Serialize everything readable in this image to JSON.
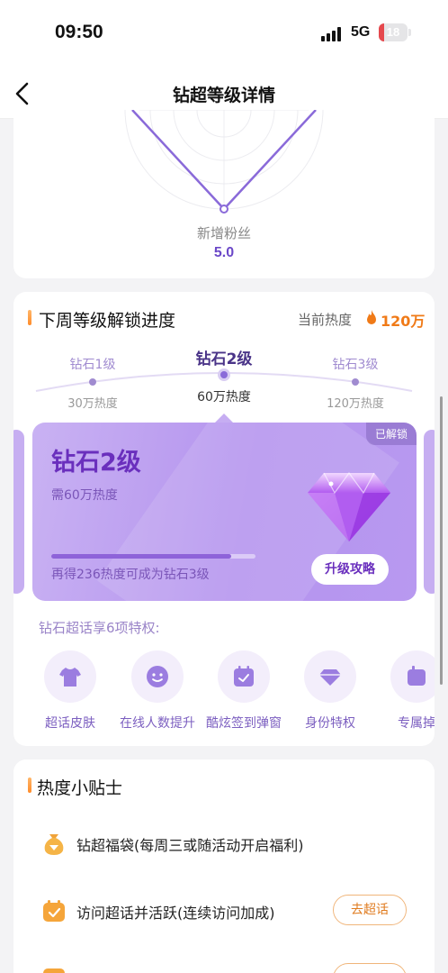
{
  "status_bar": {
    "time": "09:50",
    "network": "5G",
    "battery": "18",
    "battery_level": 0.18
  },
  "nav": {
    "title": "钻超等级详情"
  },
  "radar": {
    "axis_label": "新增粉丝",
    "axis_value": "5.0"
  },
  "unlock": {
    "title": "下周等级解锁进度",
    "current_heat_label": "当前热度",
    "current_heat_value": "120万",
    "levels": [
      {
        "name": "钻石1级",
        "heat": "30万热度"
      },
      {
        "name": "钻石2级",
        "heat": "60万热度"
      },
      {
        "name": "钻石3级",
        "heat": "120万热度"
      }
    ],
    "card": {
      "badge": "已解锁",
      "title": "钻石2级",
      "need": "需60万热度",
      "progress": 0.88,
      "tip": "再得236热度可成为钻石3级",
      "button": "升级攻略"
    },
    "perks_title": "钻石超话享6项特权:",
    "perks": [
      {
        "label": "超话皮肤",
        "icon": "tshirt-icon"
      },
      {
        "label": "在线人数提升",
        "icon": "face-icon"
      },
      {
        "label": "酷炫签到弹窗",
        "icon": "calendar-check-icon"
      },
      {
        "label": "身份特权",
        "icon": "gem-icon"
      },
      {
        "label": "专属掉",
        "icon": "badge-icon"
      }
    ]
  },
  "tips": {
    "title": "热度小贴士",
    "items": [
      {
        "text": "钻超福袋(每周三或随活动开启福利)",
        "icon": "lucky-bag-icon"
      },
      {
        "text": "访问超话并活跃(连续访问加成)",
        "icon": "calendar-check-icon",
        "button": "去超话"
      },
      {
        "text": "",
        "icon": "task-icon"
      }
    ]
  },
  "colors": {
    "accent": "#6a2fbd",
    "orange": "#f07a17",
    "card_purple": "#b493ee"
  }
}
